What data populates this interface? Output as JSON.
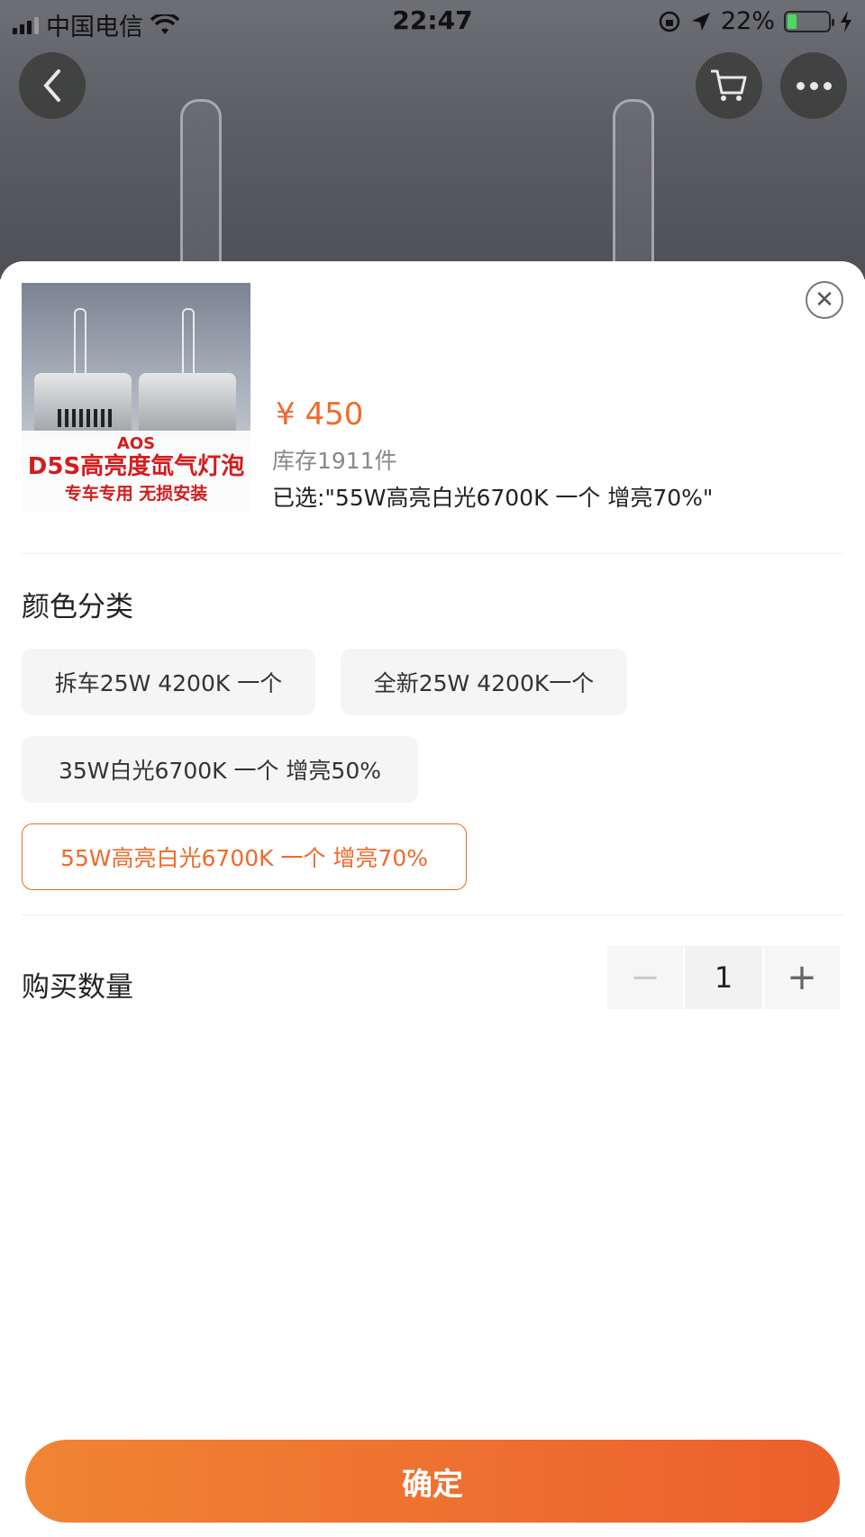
{
  "statusbar": {
    "carrier": "中国电信",
    "time": "22:47",
    "battery_percent": "22%"
  },
  "header": {
    "back_icon": "chevron-left-icon",
    "cart_icon": "cart-icon",
    "more_icon": "more-dots-icon"
  },
  "product": {
    "thumb_text_1": "AOS",
    "thumb_text_2": "D5S高亮度氙气灯泡",
    "thumb_text_3": "专车专用 无损安装",
    "price": "¥ 450",
    "stock": "库存1911件",
    "selected": "已选:\"55W高亮白光6700K 一个 增亮70%\""
  },
  "color_section": {
    "title": "颜色分类",
    "options": [
      {
        "label": "拆车25W 4200K 一个",
        "selected": false
      },
      {
        "label": "全新25W 4200K一个",
        "selected": false
      },
      {
        "label": "35W白光6700K 一个 增亮50%",
        "selected": false
      },
      {
        "label": "55W高亮白光6700K 一个 增亮70%",
        "selected": true
      }
    ]
  },
  "quantity_section": {
    "title": "购买数量",
    "minus": "−",
    "value": "1",
    "plus": "+"
  },
  "confirm_label": "确定",
  "colors": {
    "accent": "#ef6a2a",
    "button_gradient_start": "#f08434",
    "button_gradient_end": "#ec5f2c"
  }
}
